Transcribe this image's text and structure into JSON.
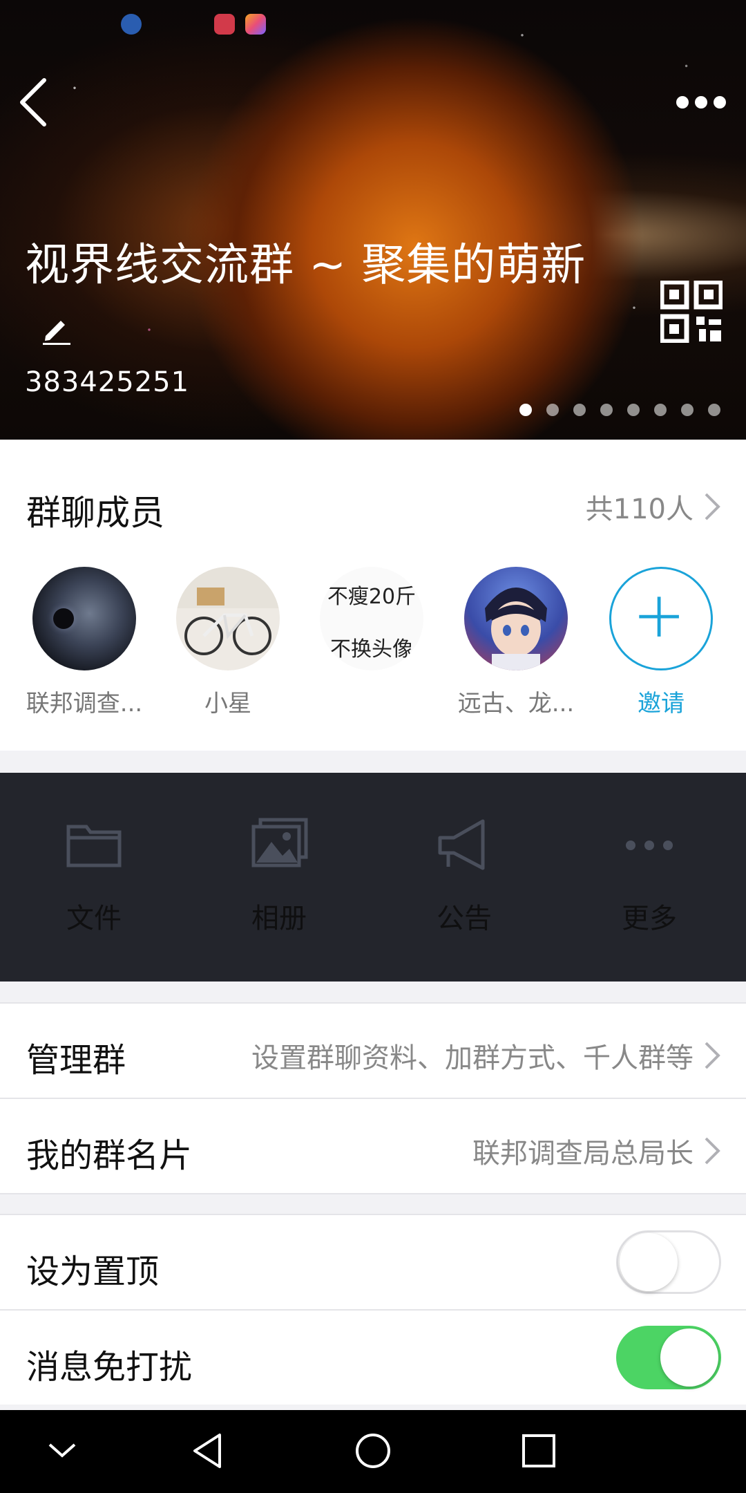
{
  "header": {
    "title": "视界线交流群 ~ 聚集的萌新",
    "group_id": "383425251",
    "page_count": 8,
    "active_page": 1
  },
  "members": {
    "title": "群聊成员",
    "count": "共110人",
    "items": [
      {
        "name": "联邦调查...",
        "avatar": "planet-avatar"
      },
      {
        "name": "小星",
        "avatar": "bicycle-avatar"
      },
      {
        "name": "",
        "avatar": "text-avatar",
        "avatar_text_line1": "不瘦20斤",
        "avatar_text_line2": "不换头像"
      },
      {
        "name": "远古、龙...",
        "avatar": "anime-boy-avatar"
      }
    ],
    "invite_label": "邀请"
  },
  "actions": [
    {
      "label": "文件",
      "icon": "folder-icon"
    },
    {
      "label": "相册",
      "icon": "photo-album-icon"
    },
    {
      "label": "公告",
      "icon": "megaphone-icon"
    },
    {
      "label": "更多",
      "icon": "more-dots-icon"
    }
  ],
  "settings": {
    "manage_group": {
      "label": "管理群",
      "value": "设置群聊资料、加群方式、千人群等"
    },
    "my_card": {
      "label": "我的群名片",
      "value": "联邦调查局总局长"
    },
    "pin_top": {
      "label": "设为置顶",
      "enabled": false
    },
    "mute": {
      "label": "消息免打扰",
      "enabled": true
    }
  },
  "colors": {
    "accent": "#1aa3d9",
    "toggle_on": "#4cd464",
    "actions_bg": "#23252c"
  }
}
